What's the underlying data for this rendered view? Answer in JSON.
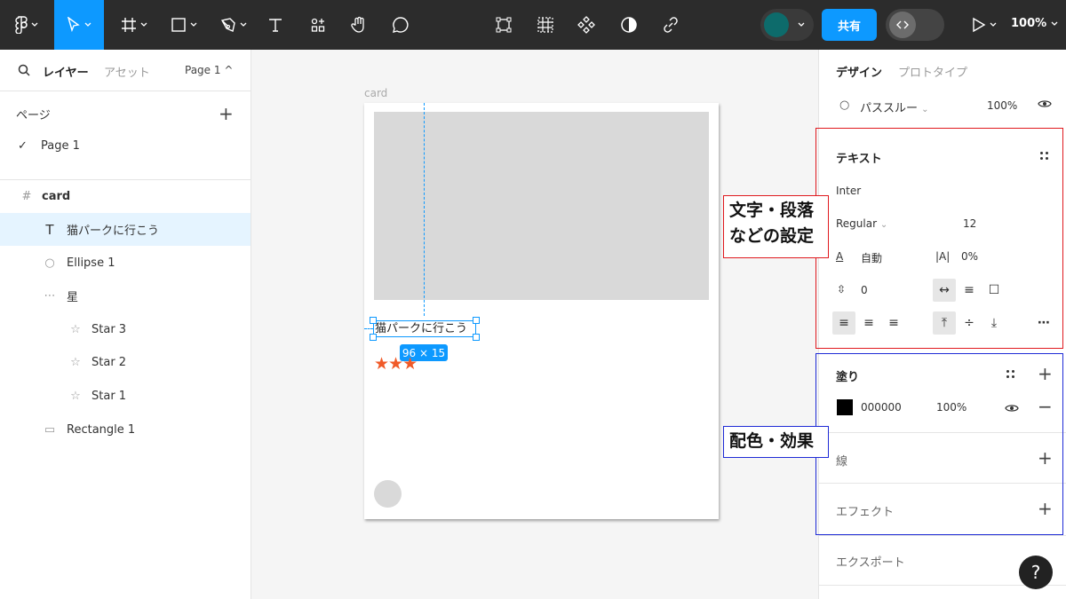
{
  "toolbar": {
    "share_label": "共有",
    "zoom": "100%",
    "colors": {
      "bg": "#2c2c2c",
      "active": "#0d99ff",
      "avatar": "#0d6b6b"
    }
  },
  "left_panel": {
    "tabs": {
      "layers": "レイヤー",
      "assets": "アセット",
      "page_select": "Page 1 ^"
    },
    "pages_heading": "ページ",
    "pages": [
      {
        "label": "Page 1",
        "checked": true
      }
    ],
    "layers": [
      {
        "label": "card",
        "icon": "frame-icon",
        "glyph": "#"
      },
      {
        "label": "猫パークに行こう",
        "icon": "text-icon",
        "glyph": "T"
      },
      {
        "label": "Ellipse 1",
        "icon": "ellipse-icon",
        "glyph": "○"
      },
      {
        "label": "星",
        "icon": "group-icon",
        "glyph": "⋯"
      },
      {
        "label": "Star 3",
        "icon": "star-icon",
        "glyph": "☆"
      },
      {
        "label": "Star 2",
        "icon": "star-icon",
        "glyph": "☆"
      },
      {
        "label": "Star 1",
        "icon": "star-icon",
        "glyph": "☆"
      },
      {
        "label": "Rectangle 1",
        "icon": "rectangle-icon",
        "glyph": "▭"
      }
    ]
  },
  "canvas": {
    "frame_label": "card",
    "text_layer": "猫パークに行こう",
    "dimensions": "96 × 15",
    "stars": "★★★",
    "star_color": "#f05a28"
  },
  "right_panel": {
    "tabs": {
      "design": "デザイン",
      "prototype": "プロトタイプ"
    },
    "blend": {
      "label": "パススルー",
      "opacity": "100%"
    },
    "text": {
      "title": "テキスト",
      "font": "Inter",
      "weight": "Regular",
      "size": "12",
      "line_height": "自動",
      "letter_spacing": "0%",
      "paragraph_spacing": "0"
    },
    "fill": {
      "title": "塗り",
      "hex": "000000",
      "opacity": "100%",
      "color": "#000000"
    },
    "stroke": {
      "title": "線"
    },
    "effects": {
      "title": "エフェクト"
    },
    "export": {
      "title": "エクスポート"
    }
  },
  "annotations": {
    "text_callout_line1": "文字・段落",
    "text_callout_line2": "などの設定",
    "fill_callout": "配色・効果",
    "colors": {
      "red": "#e0191e",
      "blue": "#1f2bd6"
    }
  },
  "help_label": "?"
}
